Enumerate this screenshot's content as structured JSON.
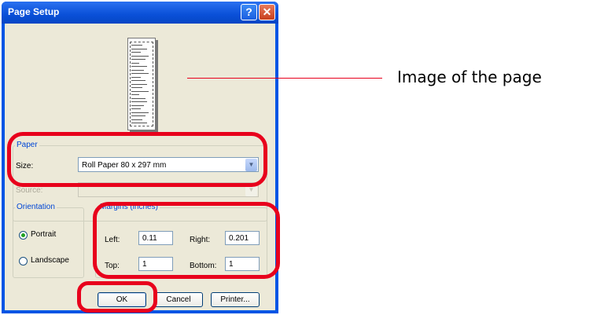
{
  "dialog": {
    "title": "Page Setup",
    "help_glyph": "?",
    "close_glyph": "✕"
  },
  "paper": {
    "group_label": "Paper",
    "size_label": "Size:",
    "size_value": "Roll Paper 80 x 297 mm",
    "source_label": "Source:",
    "source_value": ""
  },
  "orientation": {
    "group_label": "Orientation",
    "portrait_label": "Portrait",
    "landscape_label": "Landscape",
    "selected": "Portrait"
  },
  "margins": {
    "group_label": "Margins (inches)",
    "left_label": "Left:",
    "left_value": "0.11",
    "right_label": "Right:",
    "right_value": "0.201",
    "top_label": "Top:",
    "top_value": "1",
    "bottom_label": "Bottom:",
    "bottom_value": "1"
  },
  "buttons": {
    "ok": "OK",
    "cancel": "Cancel",
    "printer": "Printer..."
  },
  "annotation": {
    "callout_text": "Image of the page",
    "highlight_color": "#e8001c"
  }
}
